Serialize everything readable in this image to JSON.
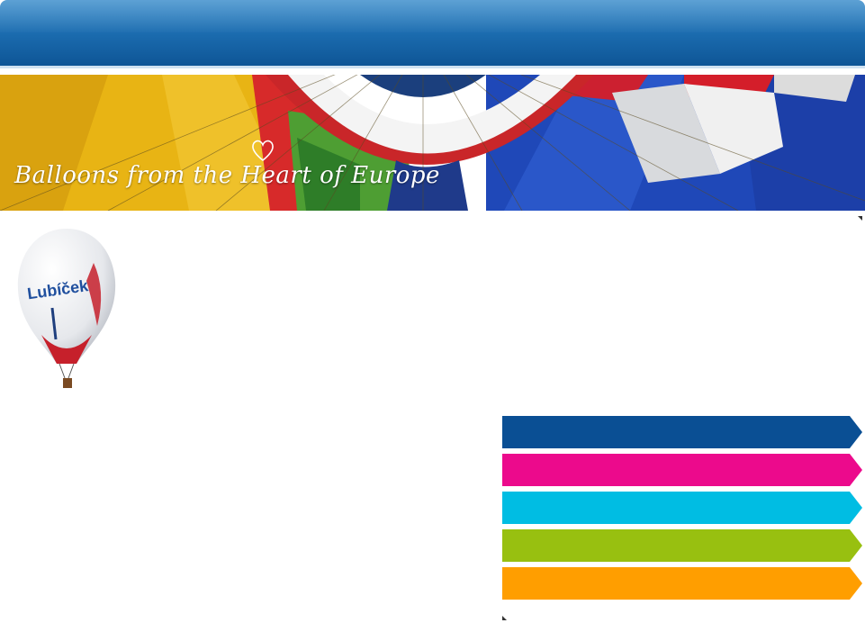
{
  "banner": {
    "tagline": "Balloons from the Heart of Europe"
  },
  "balloon": {
    "envelope_text": "Lubíček"
  },
  "colors": {
    "topbar": "#1a6aad",
    "menu": [
      "#0a4f94",
      "#ec0a8c",
      "#00bde3",
      "#98c010",
      "#ff9e00"
    ]
  },
  "menu": {
    "items": [
      {
        "label": "",
        "color": "#0a4f94"
      },
      {
        "label": "",
        "color": "#ec0a8c"
      },
      {
        "label": "",
        "color": "#00bde3"
      },
      {
        "label": "",
        "color": "#98c010"
      },
      {
        "label": "",
        "color": "#ff9e00"
      }
    ]
  }
}
